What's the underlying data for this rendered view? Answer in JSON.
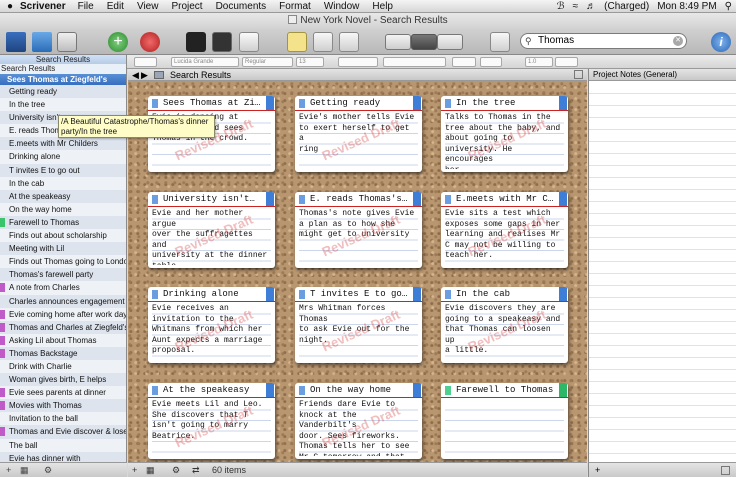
{
  "menubar": {
    "apple": "",
    "app": "Scrivener",
    "items": [
      "File",
      "Edit",
      "View",
      "Project",
      "Documents",
      "Format",
      "Window",
      "Help"
    ],
    "battery": "(Charged)",
    "clock": "Mon 8:49 PM"
  },
  "window": {
    "title": "New York Novel - Search Results"
  },
  "search": {
    "value": "Thomas"
  },
  "formatbar": {
    "font": "Lucida Grande",
    "style": "Regular",
    "size": "13",
    "spacing": "1.0"
  },
  "binder": {
    "header": "Search Results",
    "subheader": "Search Results",
    "selected": "Sees Thomas at Ziegfeld's",
    "items": [
      {
        "label": "Getting ready",
        "color": ""
      },
      {
        "label": "In the tree",
        "color": ""
      },
      {
        "label": "University isn't",
        "color": ""
      },
      {
        "label": "E. reads Thomas",
        "color": ""
      },
      {
        "label": "E.meets with Mr Childers",
        "color": ""
      },
      {
        "label": "Drinking alone",
        "color": ""
      },
      {
        "label": "T invites E to go out",
        "color": ""
      },
      {
        "label": "In the cab",
        "color": ""
      },
      {
        "label": "At the speakeasy",
        "color": ""
      },
      {
        "label": "On the way home",
        "color": ""
      },
      {
        "label": "Farewell to Thomas",
        "color": "#3cc46c"
      },
      {
        "label": "Finds out about scholarship",
        "color": ""
      },
      {
        "label": "Meeting with Lil",
        "color": ""
      },
      {
        "label": "Finds out Thomas going to London",
        "color": ""
      },
      {
        "label": "Thomas's farewell party",
        "color": ""
      },
      {
        "label": "A note from Charles",
        "color": "#c05ac8"
      },
      {
        "label": "Charles announces engagement to",
        "color": ""
      },
      {
        "label": "Evie coming home after work day",
        "color": "#c05ac8"
      },
      {
        "label": "Thomas and Charles at Ziegfeld's",
        "color": "#c05ac8"
      },
      {
        "label": "Asking Lil about Thomas",
        "color": "#c05ac8"
      },
      {
        "label": "Thomas Backstage",
        "color": "#c05ac8"
      },
      {
        "label": "Drink with Charlie",
        "color": ""
      },
      {
        "label": "Woman gives birth, E helps",
        "color": ""
      },
      {
        "label": "Evie sees parents at dinner",
        "color": "#c05ac8"
      },
      {
        "label": "Movies with Thomas",
        "color": "#c05ac8"
      },
      {
        "label": "Invitation to the ball",
        "color": ""
      },
      {
        "label": "Thomas and Evie discover & lose",
        "color": "#c05ac8"
      },
      {
        "label": "The ball",
        "color": ""
      },
      {
        "label": "Evie has dinner with",
        "color": ""
      }
    ]
  },
  "tooltip": "/A Beautiful Catastrophe/Thomas's dinner party/In the tree",
  "corkboard": {
    "header": "Search Results",
    "footer": "60 items",
    "stamp": "Revised Draft",
    "cards": [
      {
        "title": "Sees Thomas at Zi…",
        "body": "Evie is dancing at\nZiegfeld's and sees\nThomas in the crowd.",
        "stamp": true,
        "tag": "#6a9ee0",
        "corner": "#3f7ed6"
      },
      {
        "title": "Getting ready",
        "body": "Evie's mother tells Evie\nto exert herself to get a\nring",
        "stamp": true,
        "tag": "#6a9ee0",
        "corner": "#3f7ed6"
      },
      {
        "title": "In the tree",
        "body": "Talks to Thomas in the\ntree about the baby, and\nabout going to\nuniversity. He encourages\nher.",
        "stamp": true,
        "tag": "#6a9ee0",
        "corner": "#3f7ed6"
      },
      {
        "title": "University isn't…",
        "body": "Evie and her mother argue\nover the suffragettes and\nuniversity at the dinner\ntable.\nIt is clear most people…",
        "stamp": true,
        "tag": "#6a9ee0",
        "corner": "#3f7ed6"
      },
      {
        "title": "E. reads Thomas's…",
        "body": "Thomas's note gives Evie\na plan as to how she\nmight get to university",
        "stamp": true,
        "tag": "#6a9ee0",
        "corner": "#3f7ed6"
      },
      {
        "title": "E.meets with Mr C…",
        "body": "Evie sits a test which\nexposes some gaps in her\nlearning and realises Mr\nC may not be willing to\nteach her.",
        "stamp": true,
        "tag": "#6a9ee0",
        "corner": "#3f7ed6"
      },
      {
        "title": "Drinking alone",
        "body": "Evie receives an\ninvitation to the\nWhitmans from which her\nAunt expects a marriage\nproposal.",
        "stamp": true,
        "tag": "#6a9ee0",
        "corner": "#3f7ed6"
      },
      {
        "title": "T invites E to go…",
        "body": "Mrs Whitman forces Thomas\nto ask Evie out for the\nnight.",
        "stamp": true,
        "tag": "#6a9ee0",
        "corner": "#3f7ed6"
      },
      {
        "title": "In the cab",
        "body": "Evie discovers they are\ngoing to a speakeasy and\nthat Thomas can loosen up\na little.",
        "stamp": true,
        "tag": "#6a9ee0",
        "corner": "#3f7ed6"
      },
      {
        "title": "At the speakeasy",
        "body": "Evie meets Lil and Leo.\nShe discovers that T\nisn't going to marry\nBeatrice.",
        "stamp": true,
        "tag": "#6a9ee0",
        "corner": "#3f7ed6"
      },
      {
        "title": "On the way home",
        "body": "Friends dare Evie to\nknock at the Vanderbilt's\ndoor. Sees fireworks.\nThomas tells her to see\nMr C tomorrow and that M…",
        "stamp": true,
        "tag": "#6a9ee0",
        "corner": "#3f7ed6"
      },
      {
        "title": "Farewell to Thomas",
        "body": "",
        "stamp": false,
        "tag": "#4fd08e",
        "corner": "#2cb866"
      }
    ]
  },
  "notes": {
    "header": "Project Notes (General)"
  }
}
